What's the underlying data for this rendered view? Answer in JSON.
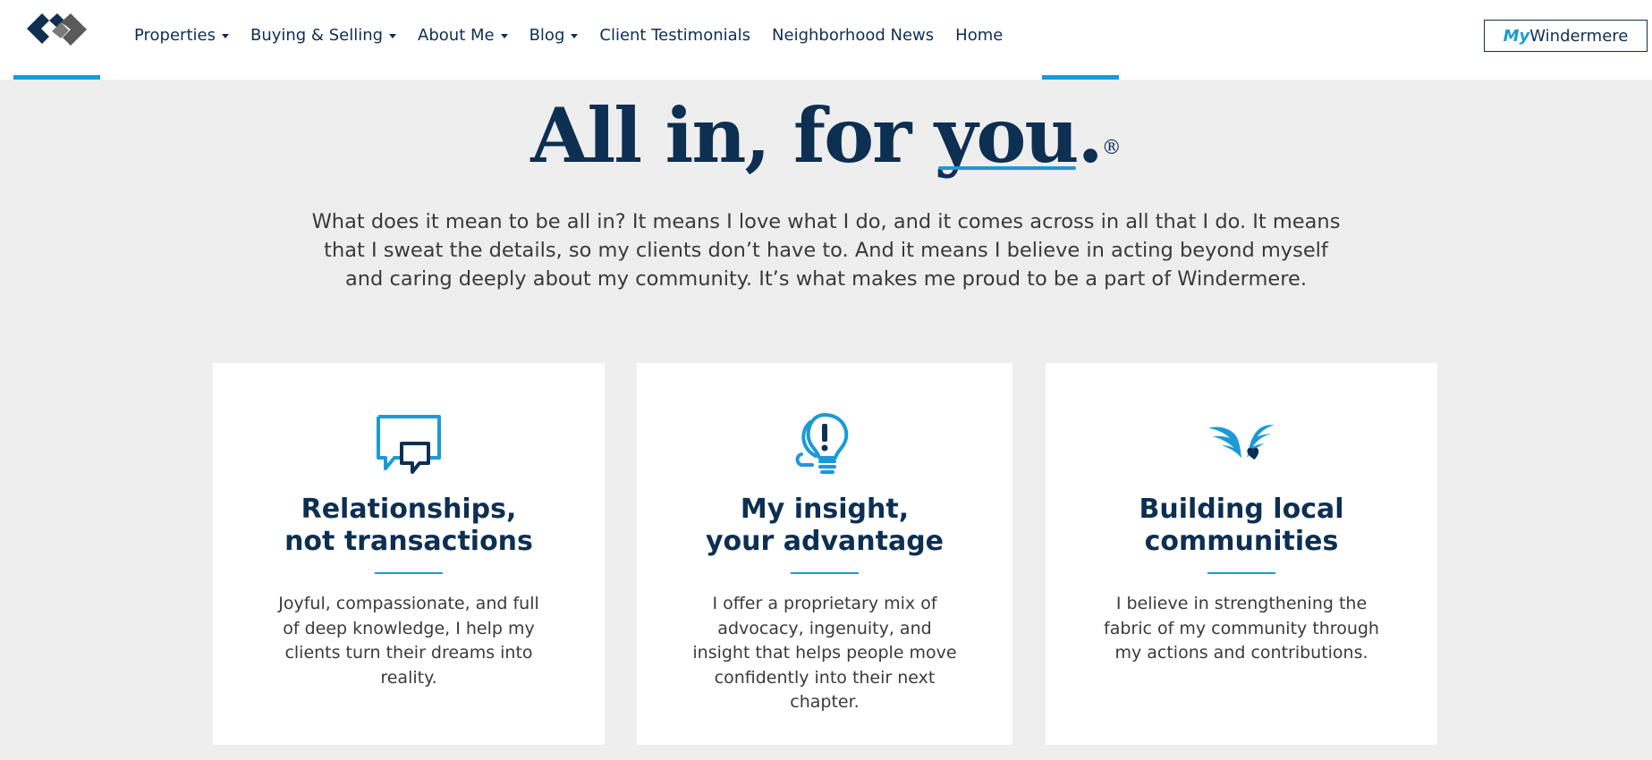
{
  "header": {
    "logo_icon": "windermere-logo-icon",
    "nav": [
      {
        "label": "Properties",
        "dropdown": true
      },
      {
        "label": "Buying & Selling",
        "dropdown": true
      },
      {
        "label": "About Me",
        "dropdown": true
      },
      {
        "label": "Blog",
        "dropdown": true
      },
      {
        "label": "Client Testimonials",
        "dropdown": false
      },
      {
        "label": "Neighborhood News",
        "dropdown": false
      },
      {
        "label": "Home",
        "dropdown": false,
        "active": true
      }
    ],
    "my_windermere": {
      "prefix": "My",
      "suffix": "Windermere"
    }
  },
  "hero": {
    "title_part1": "All in, for ",
    "title_you": "you",
    "title_period": ".",
    "title_mark": "®",
    "intro": "What does it mean to be all in? It means I love what I do, and it comes across in all that I do. It means that I sweat the details, so my clients don’t have to. And it means I believe in acting beyond myself and caring deeply about my community. It’s what makes me proud to be a part of Windermere."
  },
  "cards": [
    {
      "icon": "chat-bubbles-icon",
      "title_line1": "Relationships,",
      "title_line2": "not transactions",
      "text": "Joyful, compassionate, and full of deep knowledge, I help my clients turn their dreams into reality."
    },
    {
      "icon": "lightbulb-exclamation-icon",
      "title_line1": "My insight,",
      "title_line2": "your advantage",
      "text": "I offer a proprietary mix of advocacy, ingenuity, and insight that helps people move confidently into their next chapter."
    },
    {
      "icon": "hands-heart-icon",
      "title_line1": "Building local",
      "title_line2": "communities",
      "text": "I believe in strengthening the fabric of my community through my actions and contributions."
    }
  ],
  "colors": {
    "navy": "#0d2f52",
    "accent_blue": "#1b9ad6",
    "background": "#eeeeee"
  }
}
